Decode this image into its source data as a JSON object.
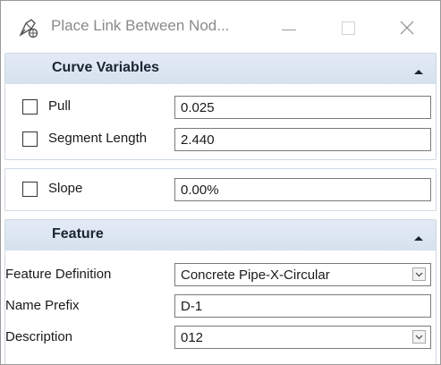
{
  "window": {
    "title": "Place Link Between Nod...",
    "icon": "pen-tool-icon"
  },
  "curve_variables": {
    "header": "Curve Variables",
    "pull": {
      "label": "Pull",
      "value": "0.025",
      "checked": false
    },
    "segment_length": {
      "label": "Segment Length",
      "value": "2.440",
      "checked": false
    }
  },
  "slope": {
    "label": "Slope",
    "value": "0.00%",
    "checked": false
  },
  "feature": {
    "header": "Feature",
    "definition": {
      "label": "Feature Definition",
      "value": "Concrete Pipe-X-Circular"
    },
    "name_prefix": {
      "label": "Name Prefix",
      "value": "D-1"
    },
    "description": {
      "label": "Description",
      "value": "012"
    }
  },
  "colors": {
    "section_header": "#dae4f0",
    "border": "#cfd8e3"
  }
}
